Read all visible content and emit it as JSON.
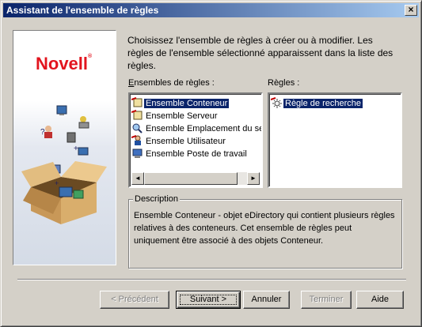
{
  "window": {
    "title": "Assistant de l'ensemble de règles",
    "close_glyph": "×"
  },
  "brand": {
    "logo_text": "Novell",
    "logo_reg": "®",
    "logo_color": "#e2141e"
  },
  "intro_text": "Choisissez l'ensemble de règles à créer ou à modifier. Les règles de l'ensemble sélectionné apparaissent dans la liste des règles.",
  "rulesets": {
    "label": "Ensembles de règles :",
    "items": [
      {
        "label": "Ensemble Conteneur",
        "icon": "container-ruleset-icon",
        "selected": true
      },
      {
        "label": "Ensemble Serveur",
        "icon": "server-ruleset-icon",
        "selected": false
      },
      {
        "label": "Ensemble Emplacement du ser",
        "icon": "search-location-ruleset-icon",
        "selected": false
      },
      {
        "label": "Ensemble Utilisateur",
        "icon": "user-ruleset-icon",
        "selected": false
      },
      {
        "label": "Ensemble Poste de travail",
        "icon": "workstation-ruleset-icon",
        "selected": false
      }
    ],
    "scroll_left": "◄",
    "scroll_right": "►"
  },
  "rules": {
    "label": "Règles :",
    "items": [
      {
        "label": "Règle de recherche",
        "icon": "search-rule-icon",
        "selected": true
      }
    ]
  },
  "description": {
    "legend": "Description",
    "text": "Ensemble Conteneur - objet eDirectory qui contient plusieurs règles relatives à des conteneurs. Cet ensemble de règles peut uniquement être associé à des objets Conteneur."
  },
  "buttons": {
    "back": "< Précédent",
    "next": "Suivant >",
    "cancel": "Annuler",
    "finish": "Terminer",
    "help": "Aide"
  },
  "colors": {
    "selection": "#0a246a",
    "title_gradient_start": "#0a246a",
    "title_gradient_end": "#a6caf0"
  }
}
